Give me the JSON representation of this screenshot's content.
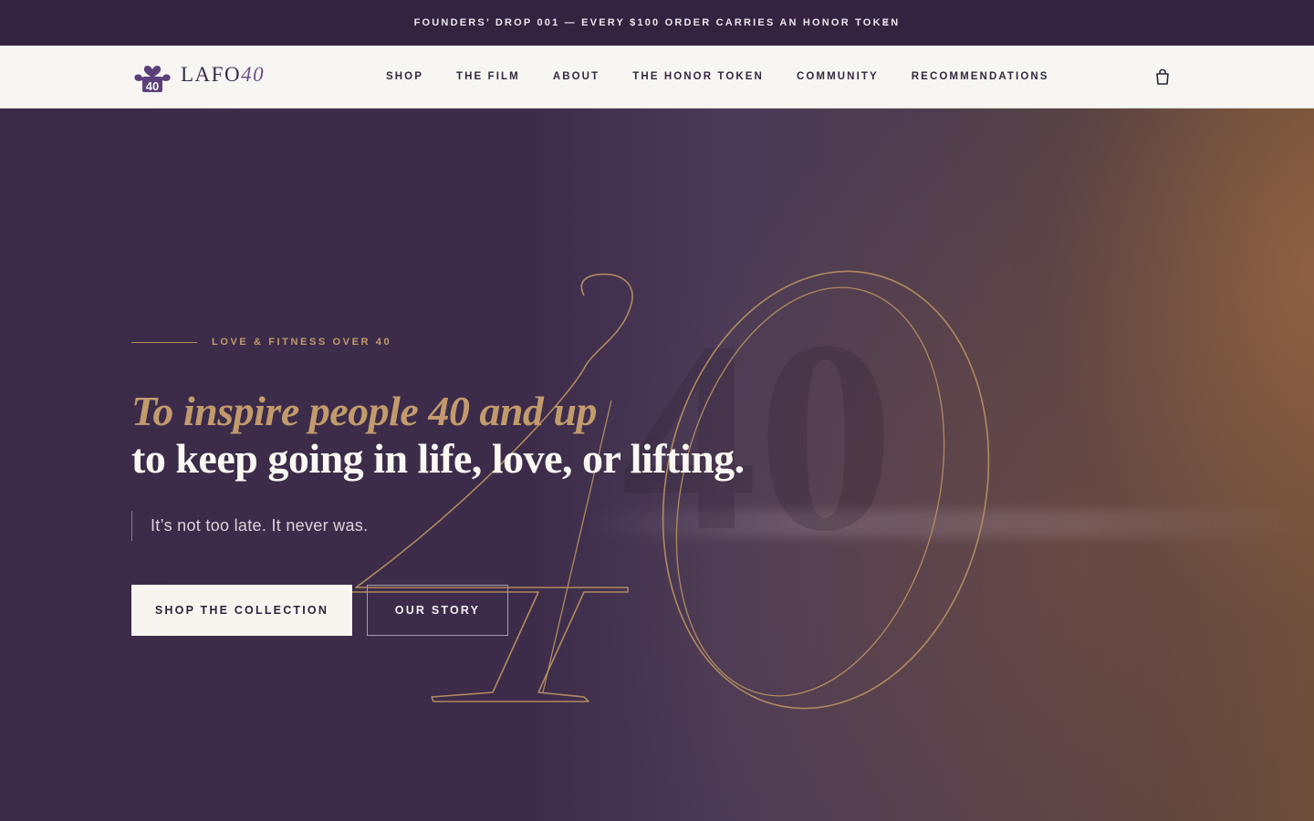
{
  "announcement": {
    "text": "FOUNDERS’ DROP 001 — EVERY $100 ORDER CARRIES AN HONOR TOKEN",
    "close_glyph": "×",
    "close_icon": "close-icon"
  },
  "header": {
    "logo": {
      "word": "LAFO",
      "number": "40",
      "mark_icon": "heart-clover-40-logo"
    },
    "nav": [
      {
        "label": "SHOP"
      },
      {
        "label": "THE FILM"
      },
      {
        "label": "ABOUT"
      },
      {
        "label": "THE HONOR TOKEN"
      },
      {
        "label": "COMMUNITY"
      },
      {
        "label": "RECOMMENDATIONS"
      }
    ],
    "cart_icon": "shopping-bag-icon"
  },
  "hero": {
    "eyebrow": "LOVE & FITNESS OVER 40",
    "headline_line1": "To inspire people 40 and up",
    "headline_line2": "to keep going in life, love, or lifting.",
    "subline": "It’s not too late. It never was.",
    "primary_cta": "SHOP THE COLLECTION",
    "secondary_cta": "OUR STORY",
    "colors": {
      "accent_gold": "#c29a6c",
      "deep_purple": "#3b2b49",
      "cream": "#f8f6f3"
    }
  }
}
